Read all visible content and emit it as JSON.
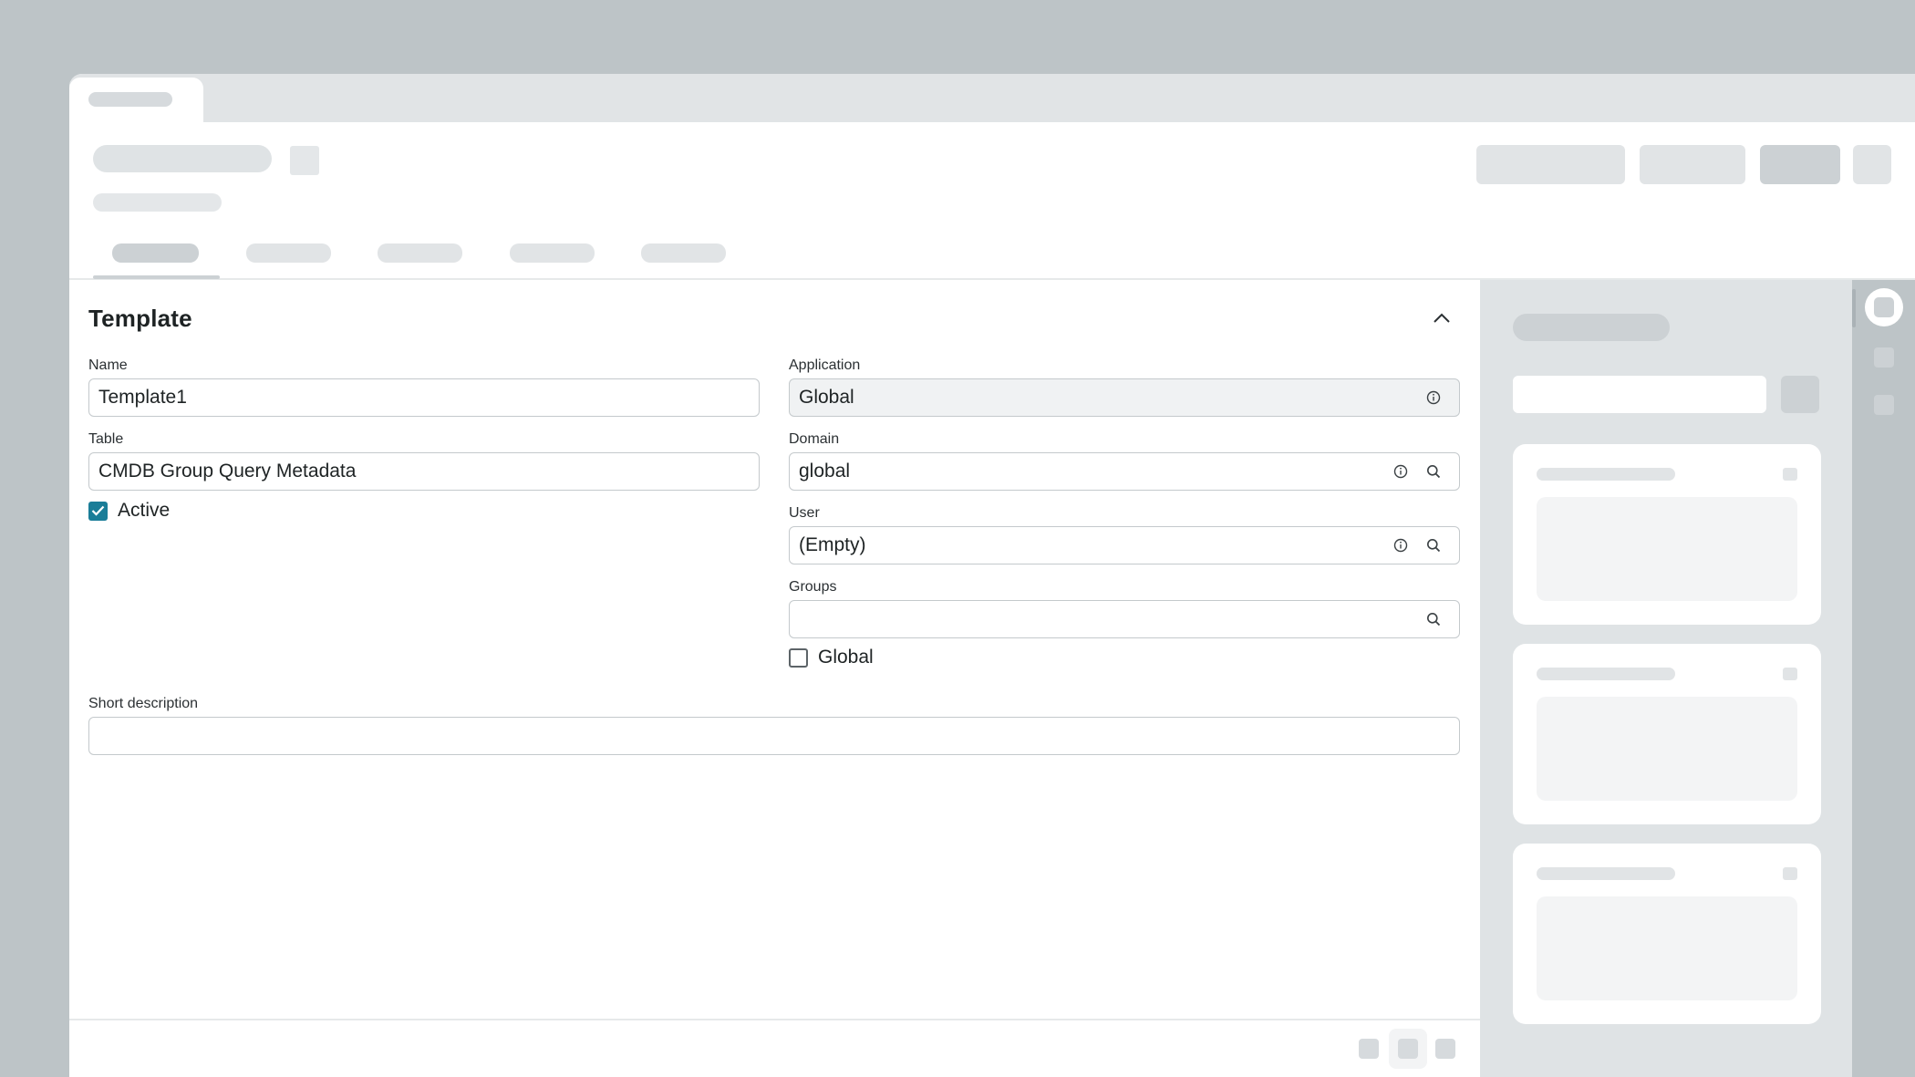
{
  "section": {
    "title": "Template",
    "collapse_icon": "chevron-up-icon"
  },
  "fields": {
    "name": {
      "label": "Name",
      "value": "Template1"
    },
    "table": {
      "label": "Table",
      "value": "CMDB Group Query Metadata"
    },
    "active": {
      "label": "Active",
      "checked": true
    },
    "application": {
      "label": "Application",
      "value": "Global",
      "icons": [
        "info-icon"
      ]
    },
    "domain": {
      "label": "Domain",
      "value": "global",
      "icons": [
        "info-icon",
        "search-icon"
      ]
    },
    "user": {
      "label": "User",
      "value": "(Empty)",
      "icons": [
        "info-icon",
        "search-icon"
      ]
    },
    "groups": {
      "label": "Groups",
      "value": "",
      "icons": [
        "search-icon"
      ]
    },
    "global": {
      "label": "Global",
      "checked": false
    },
    "short_description": {
      "label": "Short description",
      "value": ""
    }
  },
  "colors": {
    "accent": "#1a7d98",
    "background": "#bdc4c7",
    "placeholder": "#dfe3e5"
  }
}
